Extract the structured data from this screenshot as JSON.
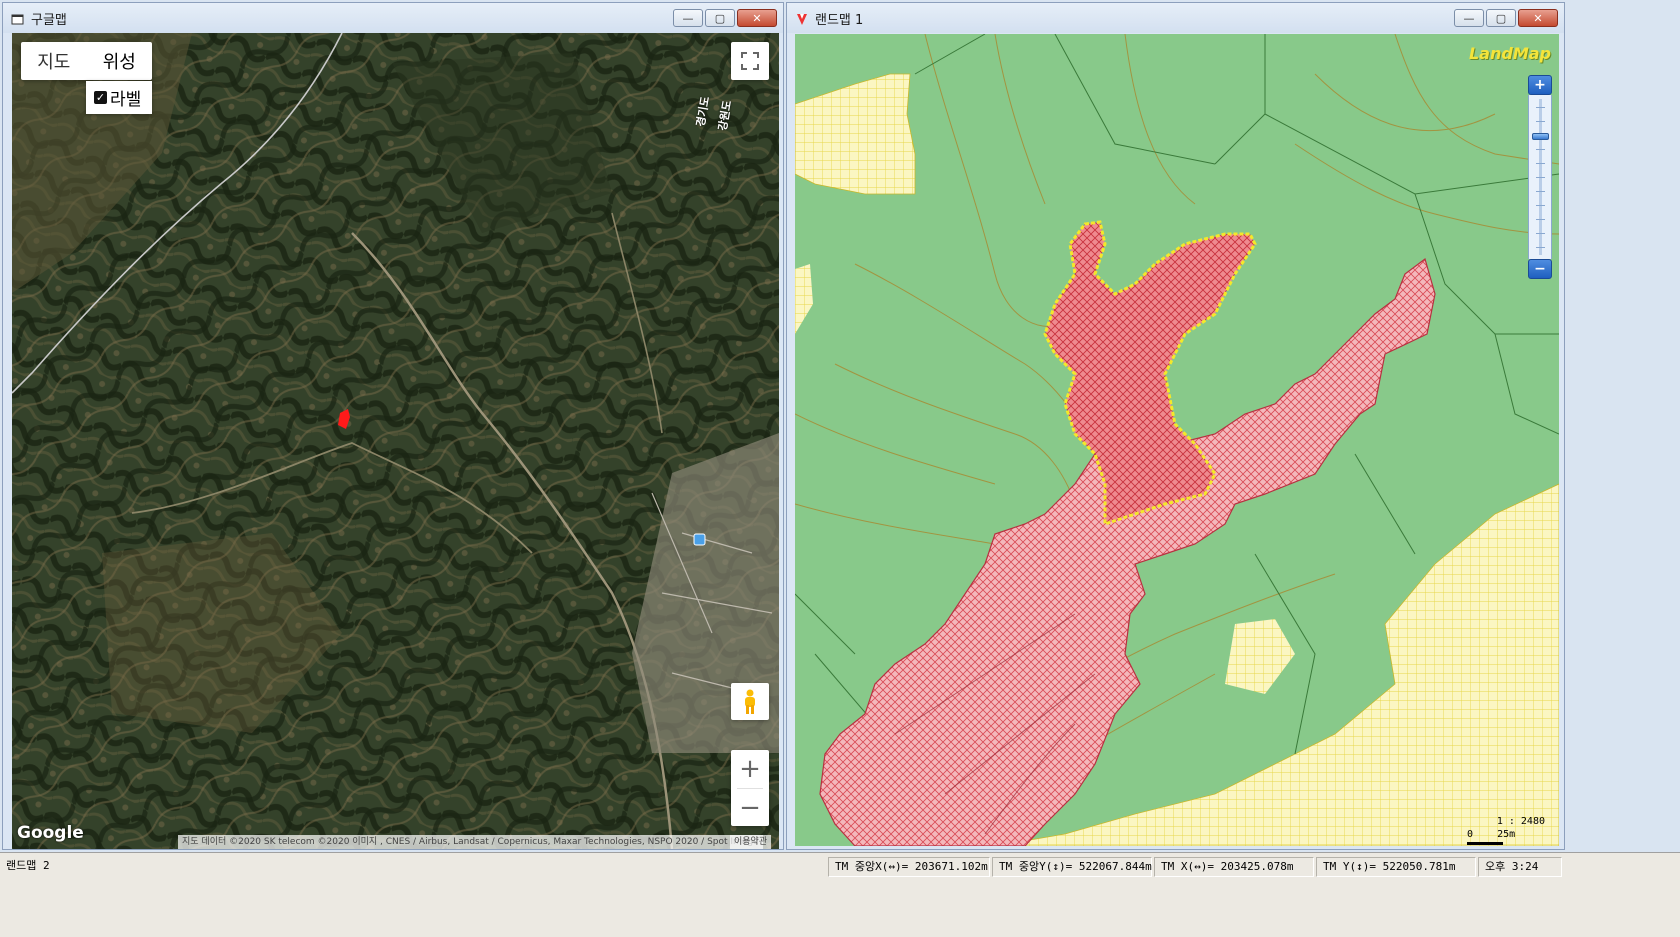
{
  "google_window": {
    "title": "구글맵",
    "buttons": {
      "minimize": "—",
      "maximize": "▢",
      "close": "✕"
    },
    "map_type": {
      "map_label": "지도",
      "satellite_label": "위성",
      "selected": "위성"
    },
    "label_checkbox": {
      "label": "라벨",
      "checked": true
    },
    "province_labels": [
      "경기도",
      "강원도"
    ],
    "logo": "Google",
    "attribution": "지도 데이터 ©2020 SK telecom ©2020 이미지 , CNES / Airbus, Landsat / Copernicus, Maxar Technologies, NSPO 2020 / Spot Image",
    "terms": "이용약관",
    "zoom_in": "+",
    "zoom_out": "−"
  },
  "landmap_window": {
    "title": "랜드맵 1",
    "buttons": {
      "minimize": "—",
      "maximize": "▢",
      "close": "✕"
    },
    "logo": "LandMap",
    "zoom_in": "+",
    "zoom_out": "−",
    "scale_ratio": "1 : 2480",
    "scale_label": "0    25m"
  },
  "status_bar": {
    "app_name": "랜드맵 2",
    "tm_center_x": "TM 중앙X(↔)= 203671.102m",
    "tm_center_y": "TM 중앙Y(↕)= 522067.844m",
    "tm_x": "TM X(↔)= 203425.078m",
    "tm_y": "TM Y(↕)= 522050.781m",
    "time": "오후 3:24"
  },
  "colors": {
    "forest_green": "#88c98a",
    "parcel_red": "#e97d80",
    "parcel_pink": "#f3b6ba",
    "yellow_grid": "#fbf6c2",
    "highlight_outline": "#f4e82a"
  }
}
